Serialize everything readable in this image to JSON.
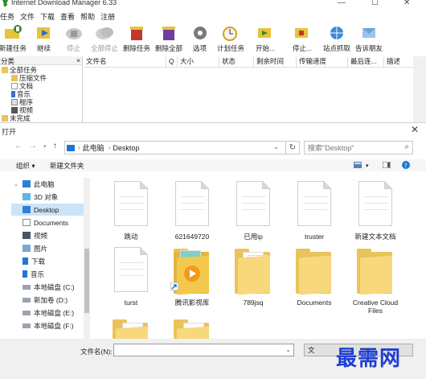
{
  "idm": {
    "title": "Internet Download Manager 6.33",
    "menu": [
      "任务",
      "文件",
      "下载",
      "查看",
      "帮助",
      "注册"
    ],
    "toolbar": [
      {
        "label": "新建任务",
        "icon": "new-task-icon",
        "disabled": false
      },
      {
        "label": "继续",
        "icon": "resume-icon",
        "disabled": false
      },
      {
        "label": "停止",
        "icon": "stop-icon",
        "disabled": true
      },
      {
        "label": "全部停止",
        "icon": "stop-all-icon",
        "disabled": true
      },
      {
        "label": "删除任务",
        "icon": "delete-task-icon",
        "disabled": false
      },
      {
        "label": "删除全部",
        "icon": "delete-all-icon",
        "disabled": false
      },
      {
        "label": "选项",
        "icon": "options-icon",
        "disabled": false
      },
      {
        "label": "计划任务",
        "icon": "scheduler-icon",
        "disabled": false
      },
      {
        "label": "开始...",
        "icon": "start-queue-icon",
        "disabled": false
      },
      {
        "label": "停止...",
        "icon": "stop-queue-icon",
        "disabled": false
      },
      {
        "label": "站点抓取",
        "icon": "site-grabber-icon",
        "disabled": false
      },
      {
        "label": "告诉朋友",
        "icon": "tell-friend-icon",
        "disabled": false
      }
    ],
    "sidebar": {
      "header": "分类",
      "items": [
        "全部任务",
        "压缩文件",
        "文档",
        "音乐",
        "程序",
        "视频",
        "未完成"
      ]
    },
    "columns": [
      "文件名",
      "Q",
      "大小",
      "状态",
      "剩余时间",
      "传输速度",
      "最后连...",
      "描述"
    ]
  },
  "dialog": {
    "title": "打开",
    "address": [
      "此电脑",
      "Desktop"
    ],
    "search_placeholder": "搜索\"Desktop\"",
    "commands": {
      "organize": "组织 ▾",
      "new_folder": "新建文件夹"
    },
    "tree": [
      {
        "label": "此电脑",
        "icon": "computer-icon"
      },
      {
        "label": "3D 对象",
        "icon": "3d-objects-icon"
      },
      {
        "label": "Desktop",
        "icon": "desktop-icon"
      },
      {
        "label": "Documents",
        "icon": "documents-icon"
      },
      {
        "label": "视频",
        "icon": "video-icon"
      },
      {
        "label": "图片",
        "icon": "pictures-icon"
      },
      {
        "label": "下载",
        "icon": "downloads-icon"
      },
      {
        "label": "音乐",
        "icon": "music-icon"
      },
      {
        "label": "本地磁盘 (C:)",
        "icon": "drive-icon"
      },
      {
        "label": "新加卷 (D:)",
        "icon": "drive-icon"
      },
      {
        "label": "本地磁盘 (E:)",
        "icon": "drive-icon"
      },
      {
        "label": "本地磁盘 (F:)",
        "icon": "drive-icon"
      }
    ],
    "files": [
      {
        "name": "跳动",
        "type": "document"
      },
      {
        "name": "621649720",
        "type": "document"
      },
      {
        "name": "已用ip",
        "type": "document"
      },
      {
        "name": "truster",
        "type": "document"
      },
      {
        "name": "新建文本文档",
        "type": "document"
      },
      {
        "name": "turst",
        "type": "document"
      },
      {
        "name": "腾讯影视库",
        "type": "app-shortcut"
      },
      {
        "name": "789jsq",
        "type": "folder"
      },
      {
        "name": "Documents",
        "type": "folder"
      },
      {
        "name": "Creative Cloud Files",
        "type": "folder"
      },
      {
        "name": "",
        "type": "folder"
      },
      {
        "name": "",
        "type": "folder"
      }
    ],
    "filename_label": "文件名(N):",
    "filename_value": "",
    "filter_value": "文"
  },
  "watermark": "最需网",
  "colors": {
    "selection": "#cce4f7",
    "folder": "#f7d87c",
    "accent": "#1c78d2",
    "watermark": "#1f3fd1"
  }
}
